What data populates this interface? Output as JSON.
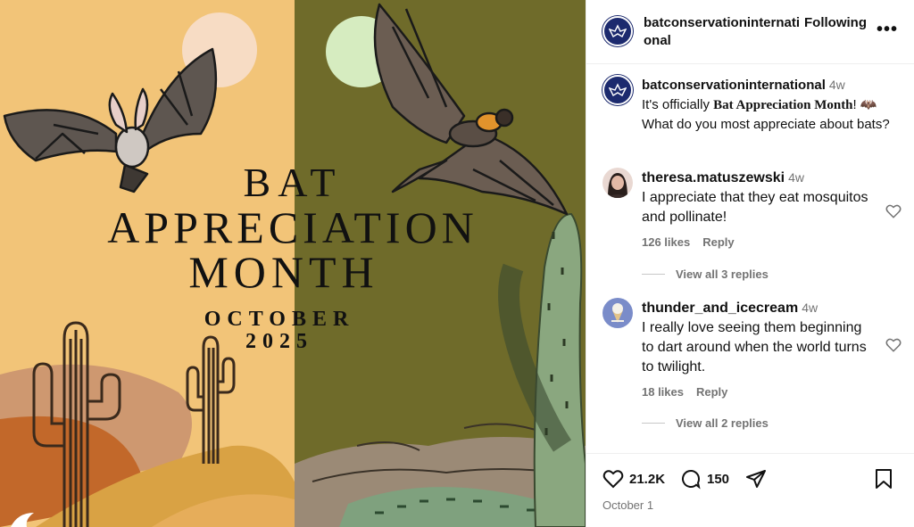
{
  "artwork": {
    "title_line1": "BAT",
    "title_line2": "APPRECIATION",
    "title_line3": "MONTH",
    "date_line1": "OCTOBER",
    "date_line2": "2025",
    "colors": {
      "left_bg": "#f2c478",
      "right_bg": "#6f6b2a",
      "moon_left": "#f7dcc4",
      "moon_right": "#d6ecc0"
    }
  },
  "header": {
    "username": "batconservationinternational",
    "follow_label": "Following",
    "more_icon": "more-icon",
    "more_glyph": "•••"
  },
  "caption": {
    "username": "batconservationinternational",
    "age": "4w",
    "text_before": "It's officially ",
    "highlight": "Bat Appreciation Month",
    "text_after": "! 🦇 What do you most appreciate about bats?"
  },
  "comments": [
    {
      "username": "theresa.matuszewski",
      "age": "4w",
      "text": "I appreciate that they eat mosquitos and pollinate!",
      "likes": "126 likes",
      "reply_label": "Reply",
      "view_replies": "View all 3 replies"
    },
    {
      "username": "thunder_and_icecream",
      "age": "4w",
      "text": "I really love seeing them beginning to dart around when the world turns to twilight.",
      "likes": "18 likes",
      "reply_label": "Reply",
      "view_replies": "View all 2 replies"
    }
  ],
  "actions": {
    "like_count": "21.2K",
    "comment_count": "150",
    "post_date": "October 1"
  }
}
